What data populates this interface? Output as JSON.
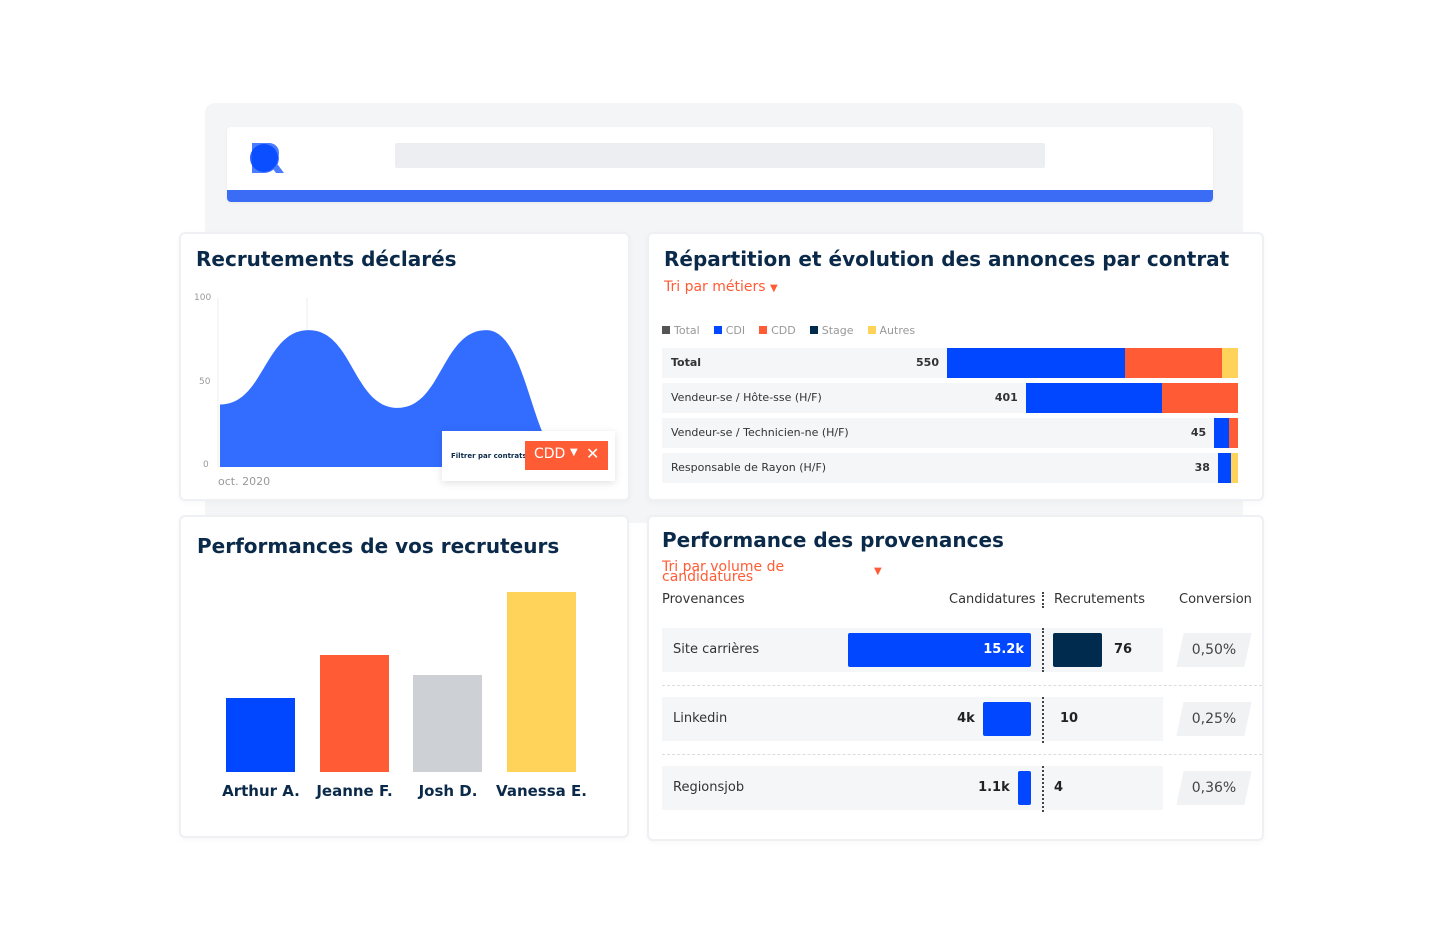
{
  "colors": {
    "blue": "#0047ff",
    "area": "#336dff",
    "orange": "#ff5c35",
    "navy": "#002b4f",
    "yellow": "#ffd35a",
    "gray": "#555555",
    "grayBar": "#cdd1d6"
  },
  "header": {
    "logo": "R"
  },
  "recrutements": {
    "title": "Recrutements déclarés",
    "filter_label": "Filtrer par contrats",
    "filter_value": "CDD",
    "chart_data": {
      "type": "area",
      "y_ticks": [
        "100",
        "50",
        "0"
      ],
      "ylim": [
        0,
        100
      ],
      "x_label": "oct. 2020",
      "values": [
        37,
        81,
        35,
        81,
        0
      ],
      "grid": false
    }
  },
  "contrats": {
    "title": "Répartition et évolution des annonces par contrat",
    "sort": "Tri par métiers",
    "chart_data": {
      "type": "bar",
      "stacked": true,
      "orientation": "horizontal",
      "legend": [
        "Total",
        "CDI",
        "CDD",
        "Stage",
        "Autres"
      ],
      "rows": [
        {
          "label": "Total",
          "total": "550",
          "total_value": 550,
          "segments": {
            "CDI": 336,
            "CDD": 184,
            "Autres": 30
          }
        },
        {
          "label": "Vendeur-se / Hôte-sse (H/F)",
          "total": "401",
          "total_value": 401,
          "segments": {
            "CDI": 258,
            "CDD": 143
          }
        },
        {
          "label": "Vendeur-se / Technicien-ne (H/F)",
          "total": "45",
          "total_value": 45,
          "segments": {
            "CDI": 28,
            "CDD": 17
          }
        },
        {
          "label": "Responsable de Rayon (H/F)",
          "total": "38",
          "total_value": 38,
          "segments": {
            "CDI": 25,
            "Autres": 13
          }
        }
      ]
    }
  },
  "recruteurs": {
    "title": "Performances de vos recruteurs",
    "chart_data": {
      "type": "bar",
      "categories": [
        "Arthur A.",
        "Jeanne F.",
        "Josh D.",
        "Vanessa E."
      ],
      "values": [
        41,
        65,
        54,
        100
      ]
    }
  },
  "provenances": {
    "title": "Performance des provenances",
    "sort": "Tri par volume de candidatures",
    "headers": {
      "source": "Provenances",
      "candidatures": "Candidatures",
      "recrutements": "Recrutements",
      "conversion": "Conversion"
    },
    "rows": [
      {
        "source": "Site carrières",
        "candidatures": "15.2k",
        "cand_value": 15200,
        "recrutements": "76",
        "recr_value": 76,
        "conversion": "0,50%"
      },
      {
        "source": "Linkedin",
        "candidatures": "4k",
        "cand_value": 4000,
        "recrutements": "10",
        "recr_value": 10,
        "conversion": "0,25%"
      },
      {
        "source": "Regionsjob",
        "candidatures": "1.1k",
        "cand_value": 1100,
        "recrutements": "4",
        "recr_value": 4,
        "conversion": "0,36%"
      }
    ]
  }
}
